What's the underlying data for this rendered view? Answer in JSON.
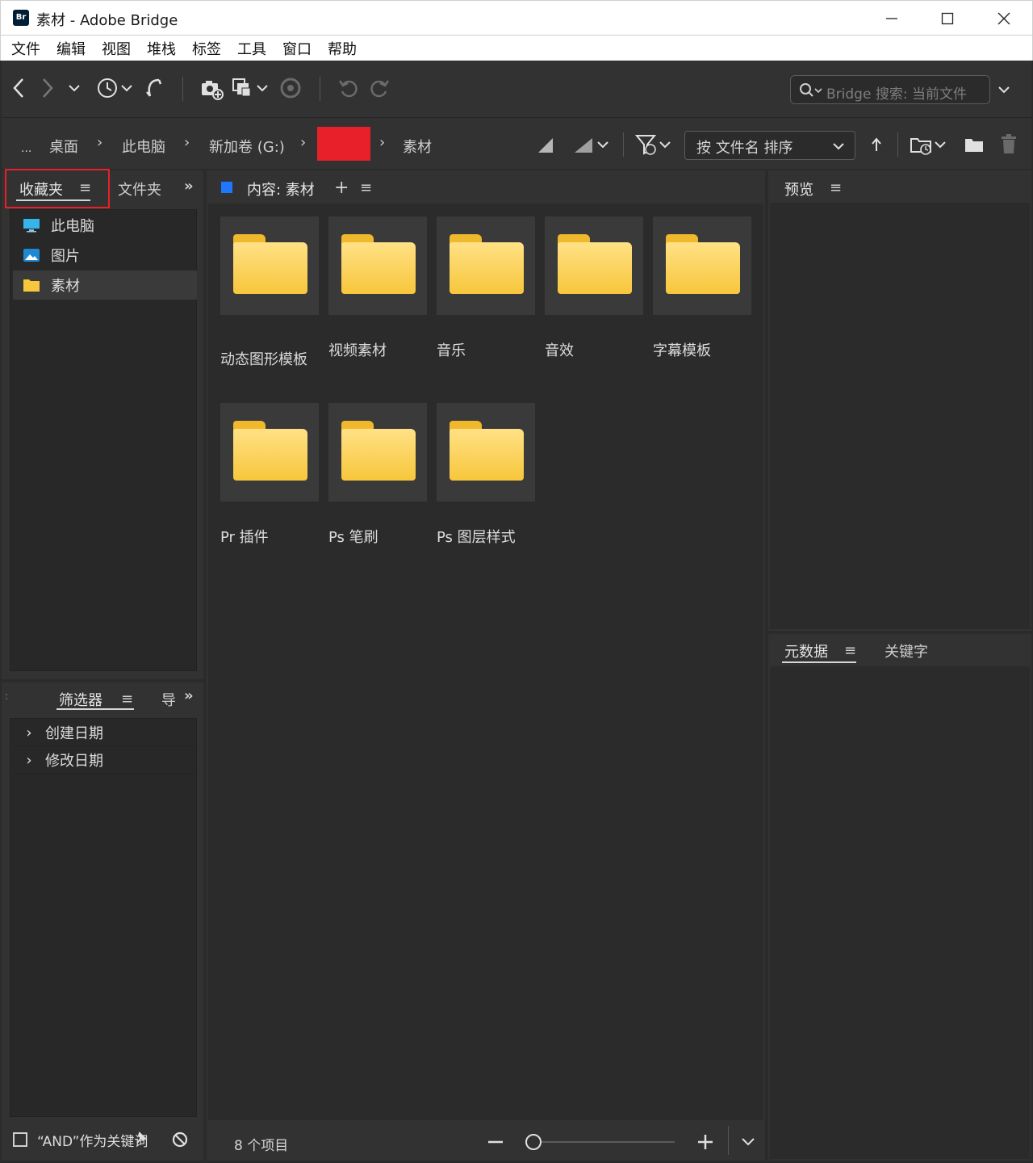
{
  "window": {
    "title": "素材 - Adobe Bridge",
    "app_badge": "Br",
    "minimize_icon": "minimize-icon",
    "maximize_icon": "maximize-icon",
    "close_icon": "close-icon"
  },
  "menu": [
    "文件",
    "编辑",
    "视图",
    "堆栈",
    "标签",
    "工具",
    "窗口",
    "帮助"
  ],
  "search": {
    "placeholder": "Bridge 搜索: 当前文件"
  },
  "path": {
    "more": "...",
    "crumbs": [
      "桌面",
      "此电脑",
      "新加卷 (G:)",
      "",
      "素材"
    ],
    "redacted_color": "#e8202a"
  },
  "sort": {
    "label": "按 文件名 排序"
  },
  "left_panel": {
    "tabs": [
      "收藏夹",
      "文件夹"
    ],
    "favorites": [
      {
        "label": "此电脑",
        "icon": "monitor-icon"
      },
      {
        "label": "图片",
        "icon": "pictures-icon"
      },
      {
        "label": "素材",
        "icon": "folder-icon",
        "selected": true
      }
    ]
  },
  "filter_panel": {
    "tabs": [
      "筛选器",
      "导"
    ],
    "items": [
      "创建日期",
      "修改日期"
    ],
    "and_keyword_label": "“AND”作为关键词"
  },
  "content": {
    "title": "内容: 素材",
    "items": [
      "动态图形模板",
      "视频素材",
      "音乐",
      "音效",
      "字幕模板",
      "Pr 插件",
      "Ps 笔刷",
      "Ps 图层样式"
    ],
    "status": "8 个项目",
    "accent_color": "#1f77ff"
  },
  "preview_panel": {
    "title": "预览"
  },
  "metadata_panel": {
    "tabs": [
      "元数据",
      "关键字"
    ]
  }
}
